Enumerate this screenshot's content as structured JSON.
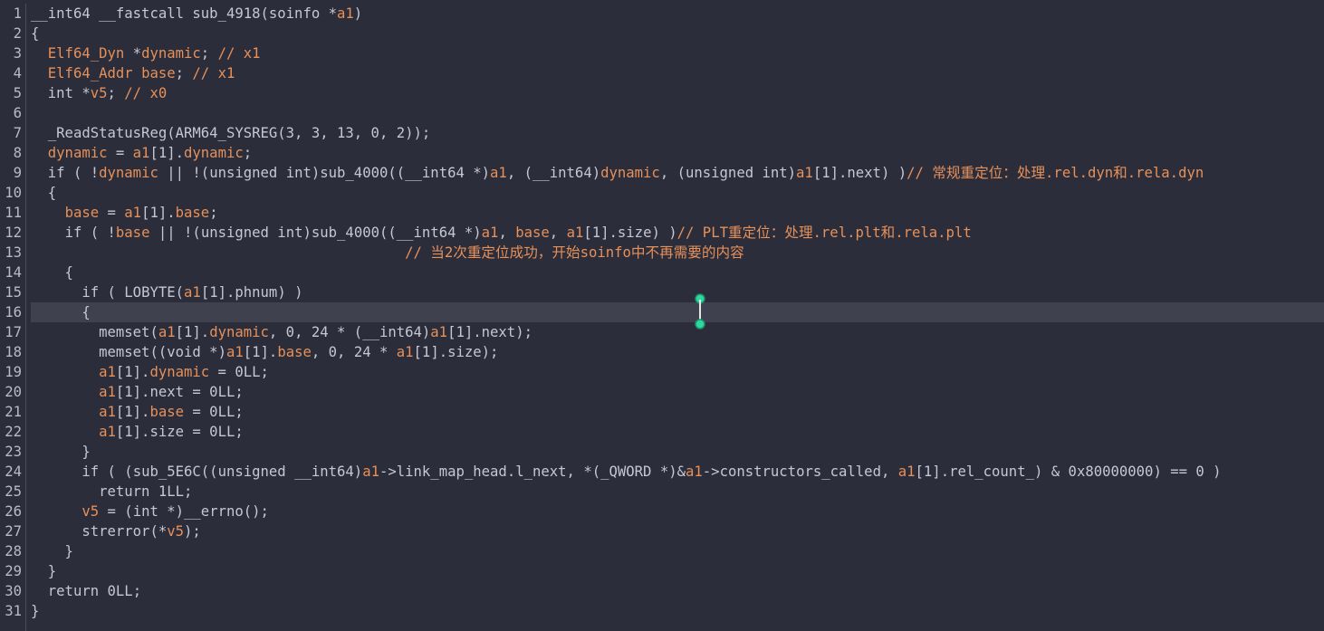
{
  "gutter": {
    "line_numbers": [
      "1",
      "2",
      "3",
      "4",
      "5",
      "6",
      "7",
      "8",
      "9",
      "10",
      "11",
      "12",
      "13",
      "14",
      "15",
      "16",
      "17",
      "18",
      "19",
      "20",
      "21",
      "22",
      "23",
      "24",
      "25",
      "26",
      "27",
      "28",
      "29",
      "30",
      "31"
    ]
  },
  "code": {
    "highlighted_line": "16",
    "lines": [
      "__int64 __fastcall sub_4918(soinfo *a1)",
      "{",
      "  Elf64_Dyn *dynamic; // x1",
      "  Elf64_Addr base; // x1",
      "  int *v5; // x0",
      "",
      "  _ReadStatusReg(ARM64_SYSREG(3, 3, 13, 0, 2));",
      "  dynamic = a1[1].dynamic;",
      "  if ( !dynamic || !(unsigned int)sub_4000((__int64 *)a1, (__int64)dynamic, (unsigned int)a1[1].next) )// 常规重定位：处理.rel.dyn和.rela.dyn",
      "  {",
      "    base = a1[1].base;",
      "    if ( !base || !(unsigned int)sub_4000((__int64 *)a1, base, a1[1].size) )// PLT重定位：处理.rel.plt和.rela.plt",
      "                                            // 当2次重定位成功，开始soinfo中不再需要的内容",
      "    {",
      "      if ( LOBYTE(a1[1].phnum) )",
      "      {",
      "        memset(a1[1].dynamic, 0, 24 * (__int64)a1[1].next);",
      "        memset((void *)a1[1].base, 0, 24 * a1[1].size);",
      "        a1[1].dynamic = 0LL;",
      "        a1[1].next = 0LL;",
      "        a1[1].base = 0LL;",
      "        a1[1].size = 0LL;",
      "      }",
      "      if ( (sub_5E6C((unsigned __int64)a1->link_map_head.l_next, *(_QWORD *)&a1->constructors_called, a1[1].rel_count_) & 0x80000000) == 0 )",
      "        return 1LL;",
      "      v5 = (int *)__errno();",
      "      strerror(*v5);",
      "    }",
      "  }",
      "  return 0LL;",
      "}"
    ]
  },
  "colors": {
    "background": "#2b2d3a",
    "text": "#c5c8d3",
    "variable": "#e6905a",
    "comment": "#e6905a",
    "current_line": "#3f414e",
    "selection_handle": "#2fd6a0"
  }
}
